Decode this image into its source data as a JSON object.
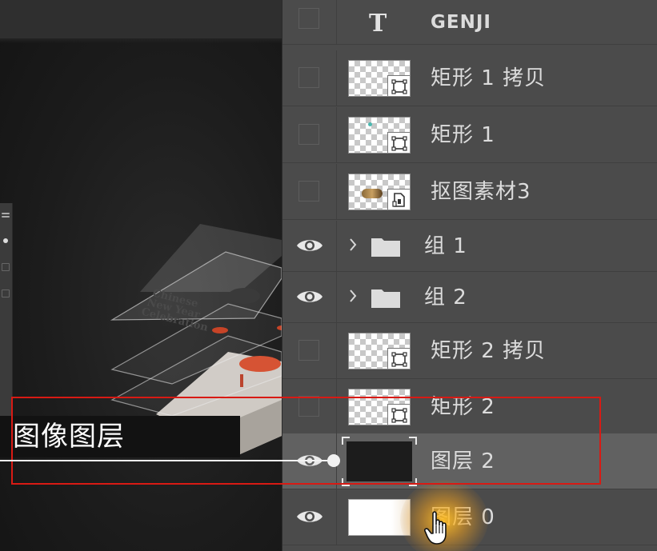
{
  "annotation": {
    "label": "图像图层",
    "highlight_color": "#d81a14"
  },
  "canvas": {
    "card_text": [
      "Chinese",
      "New Year",
      "Celebration"
    ]
  },
  "layers": [
    {
      "name": "GENJI",
      "kind": "text",
      "visible": false,
      "icon": "text-type-icon"
    },
    {
      "name": "矩形 1 拷贝",
      "kind": "shape",
      "visible": false,
      "icon": "vector-mask-icon"
    },
    {
      "name": "矩形 1",
      "kind": "shape",
      "visible": false,
      "icon": "vector-mask-icon"
    },
    {
      "name": "抠图素材3",
      "kind": "smart-object",
      "visible": false,
      "icon": "smart-object-icon"
    },
    {
      "name": "组 1",
      "kind": "group",
      "visible": true,
      "icon": "folder-icon"
    },
    {
      "name": "组 2",
      "kind": "group",
      "visible": true,
      "icon": "folder-icon"
    },
    {
      "name": "矩形 2 拷贝",
      "kind": "shape",
      "visible": false,
      "icon": "vector-mask-icon"
    },
    {
      "name": "矩形 2",
      "kind": "shape",
      "visible": false,
      "icon": "vector-mask-icon"
    },
    {
      "name": "图层 2",
      "kind": "pixel",
      "visible": true,
      "selected": true,
      "icon": "layer-thumbnail"
    },
    {
      "name": "图层 0",
      "kind": "pixel",
      "visible": true,
      "icon": "layer-thumbnail"
    }
  ],
  "colors": {
    "panel_bg": "#4b4b4b",
    "selected_row": "#616161",
    "canvas_bg": "#1c1c1c",
    "accent_red": "#d81a14",
    "cursor_glow": "#f0a020"
  }
}
